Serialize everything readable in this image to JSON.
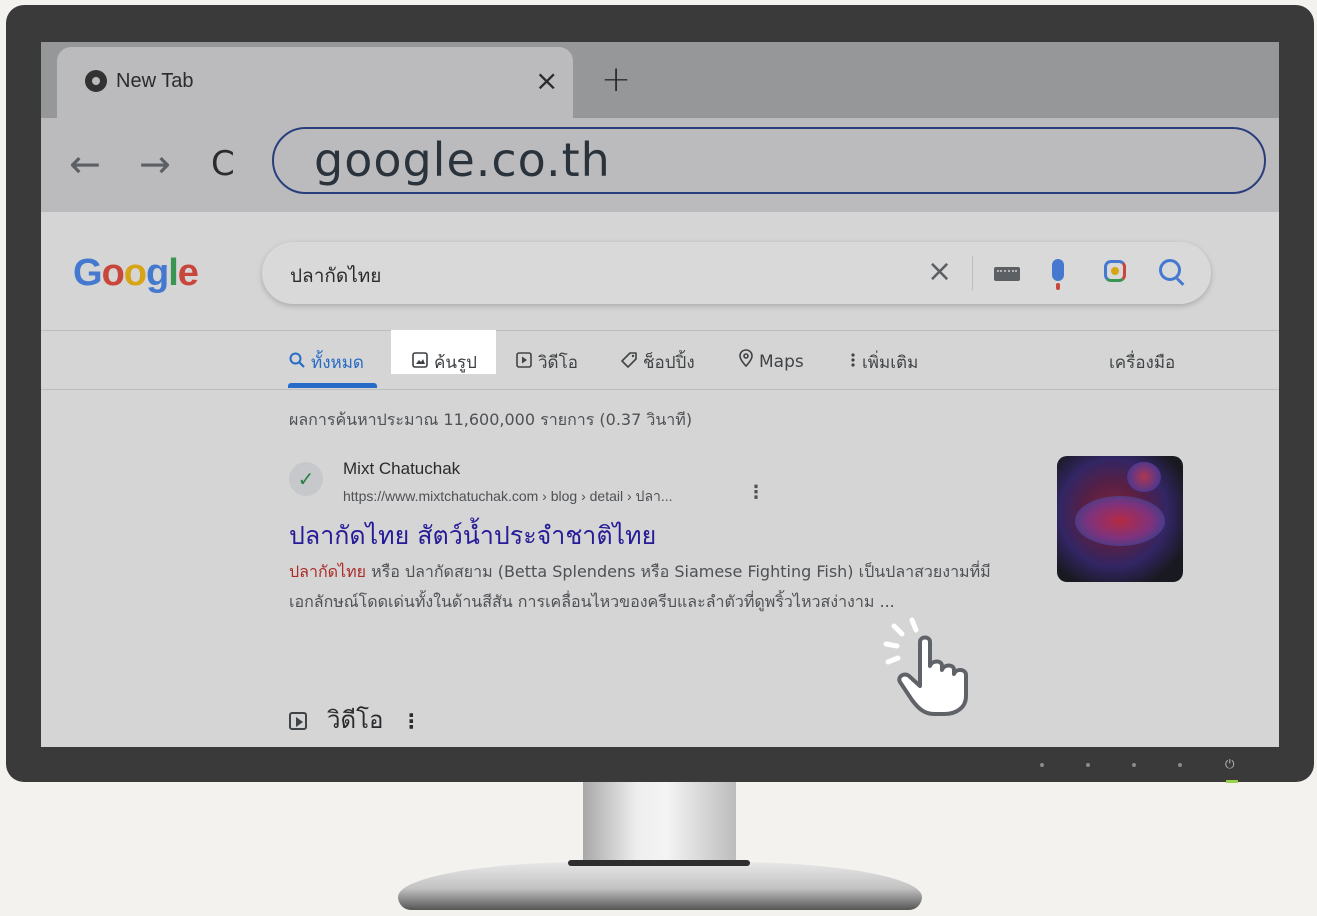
{
  "browser": {
    "tab_title": "New Tab",
    "tab_close": "×",
    "new_tab": "+",
    "back": "←",
    "forward": "→",
    "reload": "C",
    "url": "google.co.th"
  },
  "google": {
    "logo": [
      "G",
      "o",
      "o",
      "g",
      "l",
      "e"
    ],
    "logo_colors": [
      "#4285f4",
      "#ea4335",
      "#fbbc05",
      "#4285f4",
      "#34a853",
      "#ea4335"
    ],
    "search_query": "ปลากัดไทย",
    "clear": "×"
  },
  "search_tabs": {
    "all": "ทั้งหมด",
    "images": "ค้นรูป",
    "videos": "วิดีโอ",
    "shopping": "ช็อปปิ้ง",
    "maps": "Maps",
    "more": "เพิ่มเติม",
    "tools": "เครื่องมือ"
  },
  "results": {
    "count_text": "ผลการค้นหาประมาณ 11,600,000 รายการ (0.37 วินาที)",
    "items": [
      {
        "site_name": "Mixt Chatuchak",
        "url": "https://www.mixtchatuchak.com › blog › detail › ปลา...",
        "title": "ปลากัดไทย สัตว์น้ำประจำชาติไทย",
        "snippet_highlight": "ปลากัดไทย",
        "snippet_rest": " หรือ ปลากัดสยาม (Betta Splendens หรือ Siamese Fighting Fish) เป็นปลาสวยงามที่มีเอกลักษณ์โดดเด่นทั้งในด้านสีสัน การเคลื่อนไหวของครีบและลำตัวที่ดูพริ้วไหวสง่างาม ..."
      }
    ]
  },
  "video_section": {
    "title": "วิดีโอ"
  }
}
